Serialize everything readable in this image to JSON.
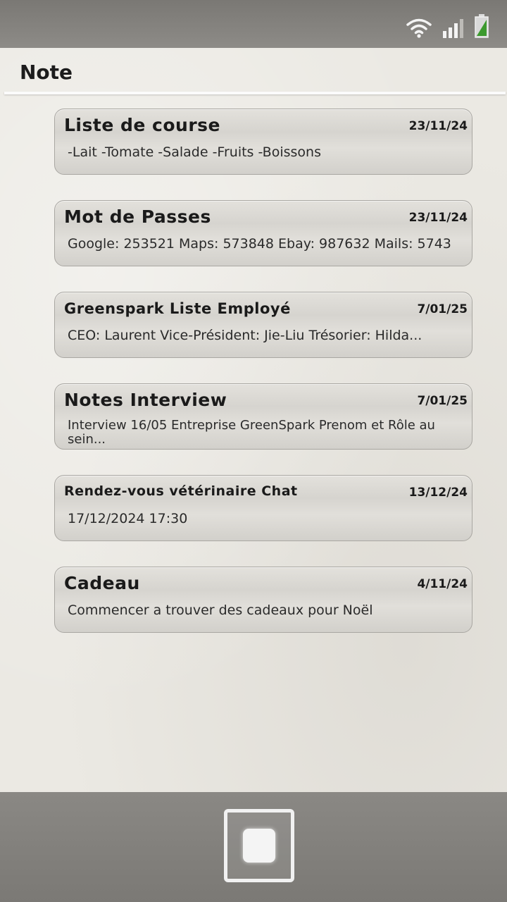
{
  "status_bar": {
    "icons": [
      "wifi-icon",
      "signal-icon",
      "battery-icon"
    ]
  },
  "header": {
    "title": "Note"
  },
  "notes": [
    {
      "title": "Liste de course",
      "date": "23/11/24",
      "preview": "-Lait -Tomate -Salade -Fruits -Boissons"
    },
    {
      "title": "Mot de Passes",
      "date": "23/11/24",
      "preview": "Google: 253521 Maps: 573848 Ebay: 987632 Mails: 5743"
    },
    {
      "title": "Greenspark Liste Employé",
      "date": "7/01/25",
      "preview": "CEO: Laurent Vice-Président: Jie-Liu Trésorier: Hilda..."
    },
    {
      "title": "Notes Interview",
      "date": "7/01/25",
      "preview": "Interview 16/05 Entreprise GreenSpark Prenom et Rôle au sein..."
    },
    {
      "title": "Rendez-vous vétérinaire Chat",
      "date": "13/12/24",
      "preview": "17/12/2024 17:30"
    },
    {
      "title": "Cadeau",
      "date": "4/11/24",
      "preview": "Commencer a trouver des cadeaux pour Noël"
    }
  ],
  "nav_bar": {
    "home_icon": "home-square-icon"
  },
  "colors": {
    "status_bar": "#7a7874",
    "background": "#ebe9e3",
    "card": "#dcdad5",
    "nav_bar": "#7b7975"
  }
}
